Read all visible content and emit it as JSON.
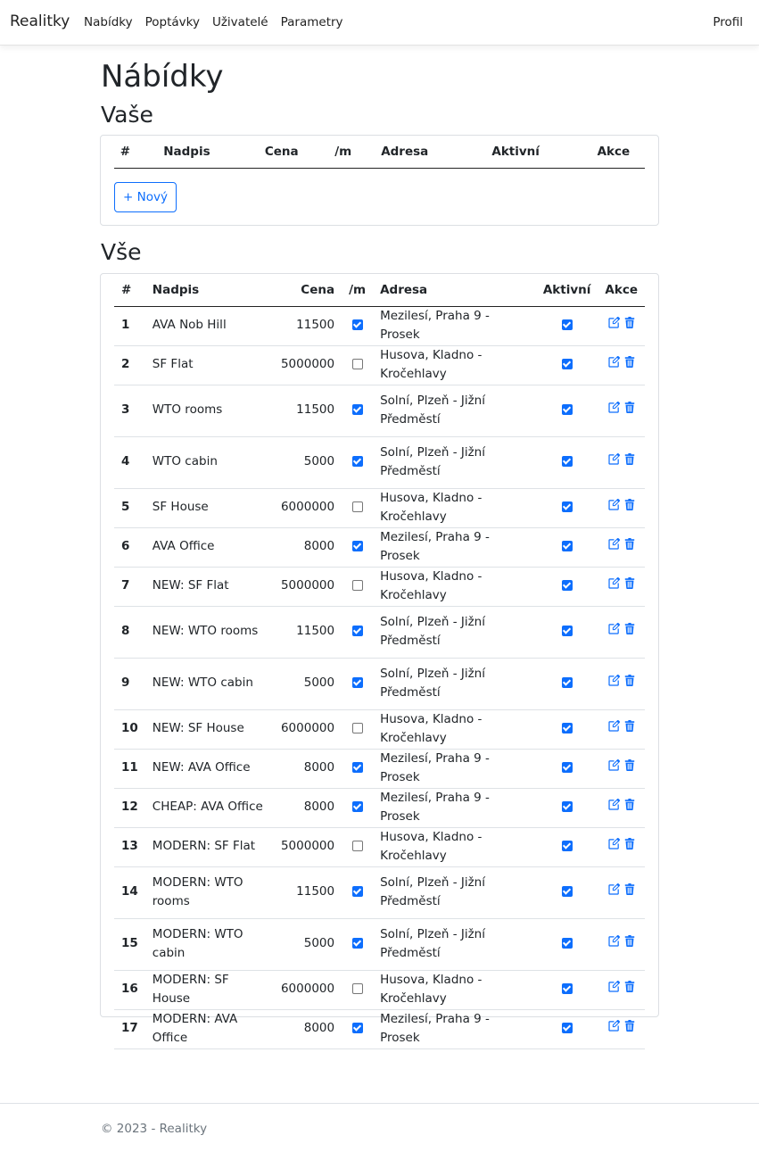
{
  "navbar": {
    "brand": "Realitky",
    "links": [
      "Nabídky",
      "Poptávky",
      "Uživatelé",
      "Parametry"
    ],
    "profile": "Profil"
  },
  "page_title": "Nábídky",
  "section_yours": {
    "title": "Vaše",
    "headers": [
      "#",
      "Nadpis",
      "Cena",
      "/m",
      "Adresa",
      "Aktivní",
      "Akce"
    ],
    "new_button": "+ Nový"
  },
  "section_all": {
    "title": "Vše",
    "headers": [
      "#",
      "Nadpis",
      "Cena",
      "/m",
      "Adresa",
      "Aktivní",
      "Akce"
    ],
    "rows": [
      {
        "id": "1",
        "title": "AVA Nob Hill",
        "price": "11500",
        "per_m": true,
        "address": "Mezilesí, Praha 9 - Prosek",
        "active": true
      },
      {
        "id": "2",
        "title": "SF Flat",
        "price": "5000000",
        "per_m": false,
        "address": "Husova, Kladno - Kročehlavy",
        "active": true
      },
      {
        "id": "3",
        "title": "WTO rooms",
        "price": "11500",
        "per_m": true,
        "address": "Solní, Plzeň - Jižní Předměstí",
        "active": true
      },
      {
        "id": "4",
        "title": "WTO cabin",
        "price": "5000",
        "per_m": true,
        "address": "Solní, Plzeň - Jižní Předměstí",
        "active": true
      },
      {
        "id": "5",
        "title": "SF House",
        "price": "6000000",
        "per_m": false,
        "address": "Husova, Kladno - Kročehlavy",
        "active": true
      },
      {
        "id": "6",
        "title": "AVA Office",
        "price": "8000",
        "per_m": true,
        "address": "Mezilesí, Praha 9 - Prosek",
        "active": true
      },
      {
        "id": "7",
        "title": "NEW: SF Flat",
        "price": "5000000",
        "per_m": false,
        "address": "Husova, Kladno - Kročehlavy",
        "active": true
      },
      {
        "id": "8",
        "title": "NEW: WTO rooms",
        "price": "11500",
        "per_m": true,
        "address": "Solní, Plzeň - Jižní Předměstí",
        "active": true
      },
      {
        "id": "9",
        "title": "NEW: WTO cabin",
        "price": "5000",
        "per_m": true,
        "address": "Solní, Plzeň - Jižní Předměstí",
        "active": true
      },
      {
        "id": "10",
        "title": "NEW: SF House",
        "price": "6000000",
        "per_m": false,
        "address": "Husova, Kladno - Kročehlavy",
        "active": true
      },
      {
        "id": "11",
        "title": "NEW: AVA Office",
        "price": "8000",
        "per_m": true,
        "address": "Mezilesí, Praha 9 - Prosek",
        "active": true
      },
      {
        "id": "12",
        "title": "CHEAP: AVA Office",
        "price": "8000",
        "per_m": true,
        "address": "Mezilesí, Praha 9 - Prosek",
        "active": true
      },
      {
        "id": "13",
        "title": "MODERN: SF Flat",
        "price": "5000000",
        "per_m": false,
        "address": "Husova, Kladno - Kročehlavy",
        "active": true
      },
      {
        "id": "14",
        "title": "MODERN: WTO rooms",
        "price": "11500",
        "per_m": true,
        "address": "Solní, Plzeň - Jižní Předměstí",
        "active": true
      },
      {
        "id": "15",
        "title": "MODERN: WTO cabin",
        "price": "5000",
        "per_m": true,
        "address": "Solní, Plzeň - Jižní Předměstí",
        "active": true
      },
      {
        "id": "16",
        "title": "MODERN: SF House",
        "price": "6000000",
        "per_m": false,
        "address": "Husova, Kladno - Kročehlavy",
        "active": true
      },
      {
        "id": "17",
        "title": "MODERN: AVA Office",
        "price": "8000",
        "per_m": true,
        "address": "Mezilesí, Praha 9 - Prosek",
        "active": true
      }
    ],
    "row_actions": [
      "edit-icon",
      "trash-icon"
    ]
  },
  "footer": {
    "text": "© 2023 - Realitky"
  },
  "colors": {
    "accent": "#0d6efd",
    "border": "#dee2e6",
    "muted": "#6c757d"
  }
}
